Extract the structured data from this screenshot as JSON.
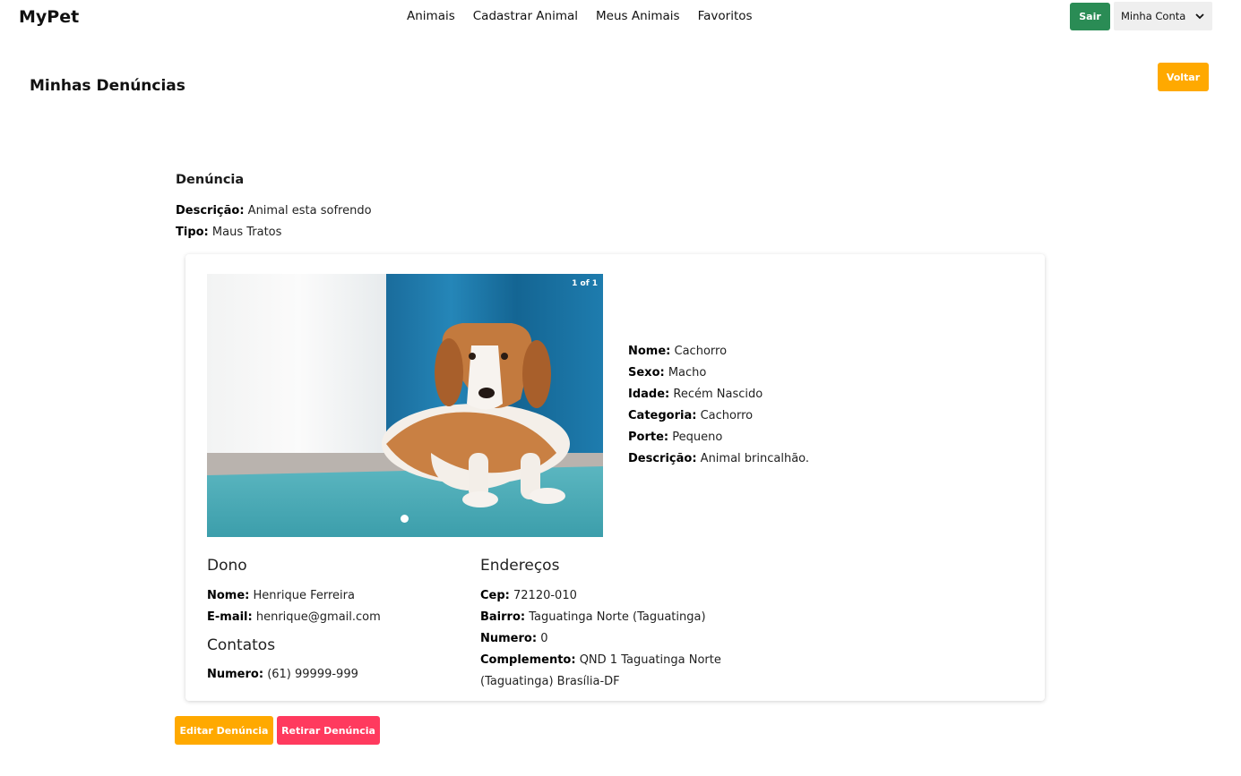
{
  "app": {
    "brand": "MyPet"
  },
  "nav": {
    "items": [
      {
        "label": "Animais"
      },
      {
        "label": "Cadastrar Animal"
      },
      {
        "label": "Meus Animais"
      },
      {
        "label": "Favoritos"
      }
    ],
    "logout_label": "Sair",
    "account_label": "Minha Conta"
  },
  "page": {
    "title": "Minhas Denúncias",
    "back_label": "Voltar"
  },
  "denuncia": {
    "heading": "Denúncia",
    "descricao_label": "Descrição:",
    "descricao": "Animal esta sofrendo",
    "tipo_label": "Tipo:",
    "tipo": "Maus Tratos"
  },
  "carousel": {
    "counter": "1 of 1"
  },
  "animal": {
    "nome_label": "Nome:",
    "nome": "Cachorro",
    "sexo_label": "Sexo:",
    "sexo": "Macho",
    "idade_label": "Idade:",
    "idade": "Recém Nascido",
    "categoria_label": "Categoria:",
    "categoria": "Cachorro",
    "porte_label": "Porte:",
    "porte": "Pequeno",
    "descricao_label": "Descrição:",
    "descricao": "Animal brincalhão."
  },
  "dono": {
    "heading": "Dono",
    "nome_label": "Nome:",
    "nome": "Henrique Ferreira",
    "email_label": "E-mail:",
    "email": "henrique@gmail.com"
  },
  "contatos": {
    "heading": "Contatos",
    "numero_label": "Numero:",
    "numero": "(61) 99999-999"
  },
  "enderecos": {
    "heading": "Endereços",
    "cep_label": "Cep:",
    "cep": "72120-010",
    "bairro_label": "Bairro:",
    "bairro": "Taguatinga Norte (Taguatinga)",
    "numero_label": "Numero:",
    "numero": "0",
    "complemento_label": "Complemento:",
    "complemento": "QND 1 Taguatinga Norte (Taguatinga) Brasília-DF"
  },
  "actions": {
    "edit_label": "Editar Denúncia",
    "remove_label": "Retirar Denúncia"
  },
  "colors": {
    "logout": "#2a8c55",
    "primary": "#ffa900",
    "danger": "#ff3a5e"
  }
}
